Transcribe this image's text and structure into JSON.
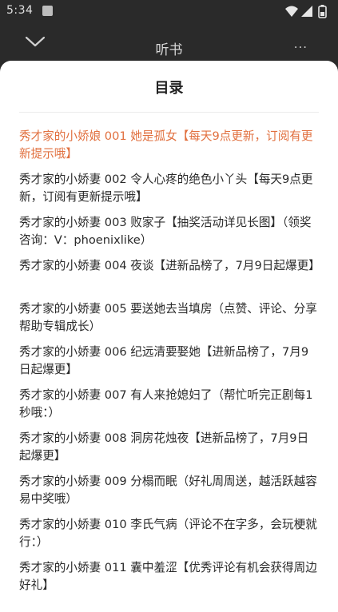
{
  "status_bar": {
    "time": "5:34"
  },
  "header": {
    "title": "听书",
    "more_label": "..."
  },
  "sheet": {
    "title": "目录",
    "active_index": 0,
    "active_color": "#e1703f",
    "chapters": [
      "秀才家的小娇娘 001 她是孤女【每天9点更新，订阅有更新提示哦】",
      "秀才家的小娇妻 002 令人心疼的绝色小丫头【每天9点更新，订阅有更新提示哦】",
      "秀才家的小娇妻 003 败家子【抽奖活动详见长图】（领奖咨询：V：phoenixlike）",
      "秀才家的小娇妻 004 夜谈【进新品榜了，7月9日起爆更】",
      "秀才家的小娇妻 005 要送她去当填房（点赞、评论、分享帮助专辑成长）",
      "秀才家的小娇妻 006 纪远清要娶她【进新品榜了，7月9日起爆更】",
      "秀才家的小娇妻 007 有人来抢媳妇了（帮忙听完正剧每1秒哦：）",
      "秀才家的小娇妻 008 洞房花烛夜【进新品榜了，7月9日起爆更】",
      "秀才家的小娇妻 009 分榻而眠（好礼周周送，越活跃越容易中奖哦）",
      "秀才家的小娇妻 010 李氏气病（评论不在字多，会玩梗就行：）",
      "秀才家的小娇妻 011 囊中羞涩【优秀评论有机会获得周边好礼】"
    ]
  }
}
